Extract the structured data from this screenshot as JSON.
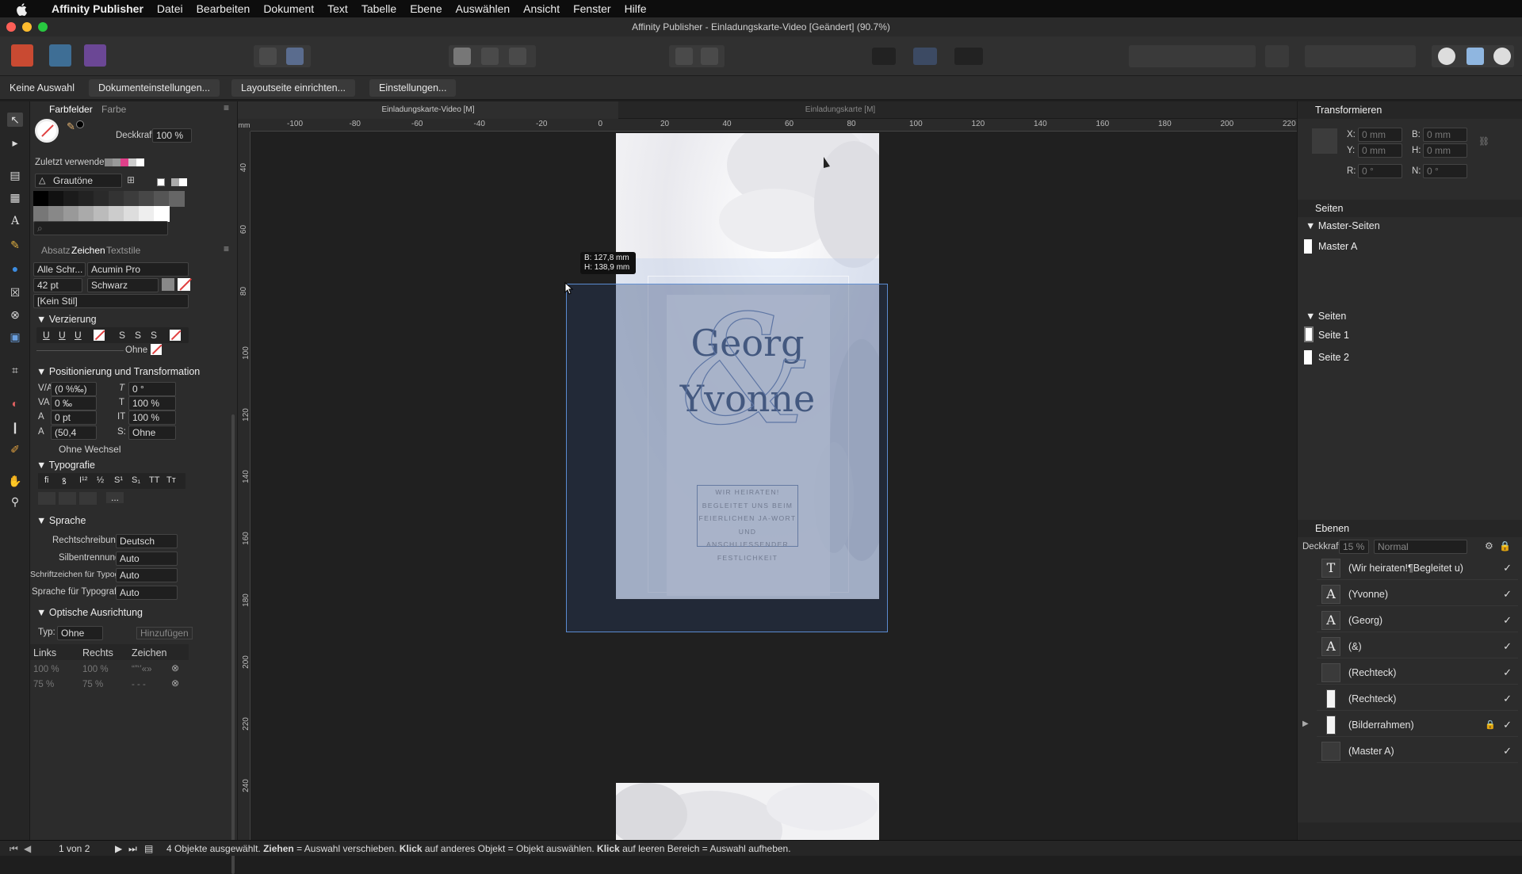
{
  "menubar": {
    "apple": "",
    "app": "Affinity Publisher",
    "items": [
      "Datei",
      "Bearbeiten",
      "Dokument",
      "Text",
      "Tabelle",
      "Ebene",
      "Auswählen",
      "Ansicht",
      "Fenster",
      "Hilfe"
    ]
  },
  "window": {
    "title": "Affinity Publisher - Einladungskarte-Video [Geändert] (90.7%)"
  },
  "context": {
    "selection": "Keine Auswahl",
    "buttons": [
      "Dokumenteinstellungen...",
      "Layoutseite einrichten...",
      "Einstellungen..."
    ]
  },
  "doctabs": [
    "Einladungskarte-Video [M]",
    "Einladungskarte [M]"
  ],
  "ruler": {
    "h": [
      "-100",
      "-80",
      "-60",
      "-40",
      "-20",
      "0",
      "20",
      "40",
      "60",
      "80",
      "100",
      "120",
      "140",
      "160",
      "180",
      "200",
      "220"
    ],
    "v": [
      "40",
      "60",
      "80",
      "100",
      "120",
      "140",
      "160",
      "180",
      "200",
      "220",
      "240"
    ]
  },
  "swatches": {
    "tabs": [
      "Farbfelder",
      "Farbe"
    ],
    "opacity_label": "Deckkraft:",
    "opacity_value": "100 %",
    "recent_label": "Zuletzt verwendet:",
    "palette": "Grautöne",
    "grays": [
      "#000000",
      "#111111",
      "#1b1b1b",
      "#222222",
      "#2a2a2a",
      "#333333",
      "#3c3c3c",
      "#474747",
      "#555555",
      "#666666",
      "#777777",
      "#888888",
      "#999999",
      "#aaaaaa",
      "#bbbbbb",
      "#cccccc",
      "#dddddd",
      "#eeeeee",
      "#ffffff"
    ]
  },
  "character": {
    "tabs": [
      "Absatz",
      "Zeichen",
      "Textstile"
    ],
    "font_collection": "Alle Schr...",
    "font_family": "Acumin Pro",
    "font_size": "42 pt",
    "font_style": "Schwarz",
    "style": "[Kein Stil]",
    "decoration": {
      "header": "Verzierung",
      "buttons": [
        "U",
        "U",
        "U",
        "S",
        "S",
        "S"
      ],
      "line_label": "Ohne"
    },
    "position": {
      "header": "Positionierung und Transformation",
      "tracking": "(0 %‰)",
      "kerning": "0 ‰",
      "baseline": "0 pt",
      "leading": "(50,4",
      "skew": "0 °",
      "vscale": "100 %",
      "hscale": "100 %",
      "caps": "Ohne",
      "no_break": "Ohne Wechsel"
    },
    "typography": {
      "header": "Typografie",
      "glyphs": [
        "fi",
        "ꝸ",
        "I¹²",
        "½",
        "S¹",
        "S₁",
        "TT",
        "Tт"
      ],
      "more": "..."
    },
    "language": {
      "header": "Sprache",
      "rows": [
        {
          "label": "Rechtschreibung:",
          "value": "Deutsch"
        },
        {
          "label": "Silbentrennung:",
          "value": "Auto"
        },
        {
          "label": "Schriftzeichen für Typografie:",
          "value": "Auto"
        },
        {
          "label": "Sprache für Typografie:",
          "value": "Auto"
        }
      ]
    },
    "optical": {
      "header": "Optische Ausrichtung",
      "type_label": "Typ:",
      "type_value": "Ohne",
      "add_button": "Hinzufügen",
      "cols": [
        "Links",
        "Rechts",
        "Zeichen"
      ],
      "rows": [
        [
          "100 %",
          "100 %",
          "“”‘’«»"
        ],
        [
          "75 %",
          "75 %",
          "- - -"
        ]
      ]
    }
  },
  "tooltip": {
    "w": "B: 127,8 mm",
    "h": "H: 138,9 mm"
  },
  "card": {
    "name1": "Georg",
    "name2": "Yvonne",
    "amp": "&",
    "invite": [
      "WIR HEIRATEN!",
      "BEGLEITET UNS BEIM",
      "FEIERLICHEN JA-WORT",
      "UND ANSCHLIESSENDER",
      "FESTLICHKEIT"
    ]
  },
  "transform": {
    "header": "Transformieren",
    "x_label": "X:",
    "x": "0 mm",
    "y_label": "Y:",
    "y": "0 mm",
    "b_label": "B:",
    "b": "0 mm",
    "h_label": "H:",
    "h": "0 mm",
    "r_label": "R:",
    "r": "0 °",
    "n_label": "N:",
    "n": "0 °"
  },
  "pages": {
    "header": "Seiten",
    "master_header": "Master-Seiten",
    "masters": [
      "Master A"
    ],
    "pages_header": "Seiten",
    "pages": [
      "Seite 1",
      "Seite 2"
    ]
  },
  "layers": {
    "header": "Ebenen",
    "opacity_label": "Deckkraft:",
    "opacity": "15 %",
    "blend": "Normal",
    "items": [
      {
        "icon": "T",
        "name": "(Wir heiraten!¶Begleitet u)"
      },
      {
        "icon": "A",
        "name": "(Yvonne)"
      },
      {
        "icon": "A",
        "name": "(Georg)"
      },
      {
        "icon": "A",
        "name": "(&)"
      },
      {
        "icon": "",
        "name": "(Rechteck)"
      },
      {
        "icon": "",
        "name": "(Rechteck)"
      },
      {
        "icon": "",
        "name": "(Bilderrahmen)"
      },
      {
        "icon": "",
        "name": "(Master A)"
      }
    ]
  },
  "status": {
    "pages": "1 von 2",
    "message_prefix": "4 Objekte ausgewählt.",
    "drag": "Ziehen",
    "drag_text": "= Auswahl verschieben.",
    "click1": "Klick",
    "click1_text": "auf anderes Objekt = Objekt auswählen.",
    "click2": "Klick",
    "click2_text": "auf leeren Bereich = Auswahl aufheben."
  },
  "colors": {
    "accent": "#4a6fa5",
    "text_blue": "#3d5278",
    "selection": "#5b8bd1"
  }
}
